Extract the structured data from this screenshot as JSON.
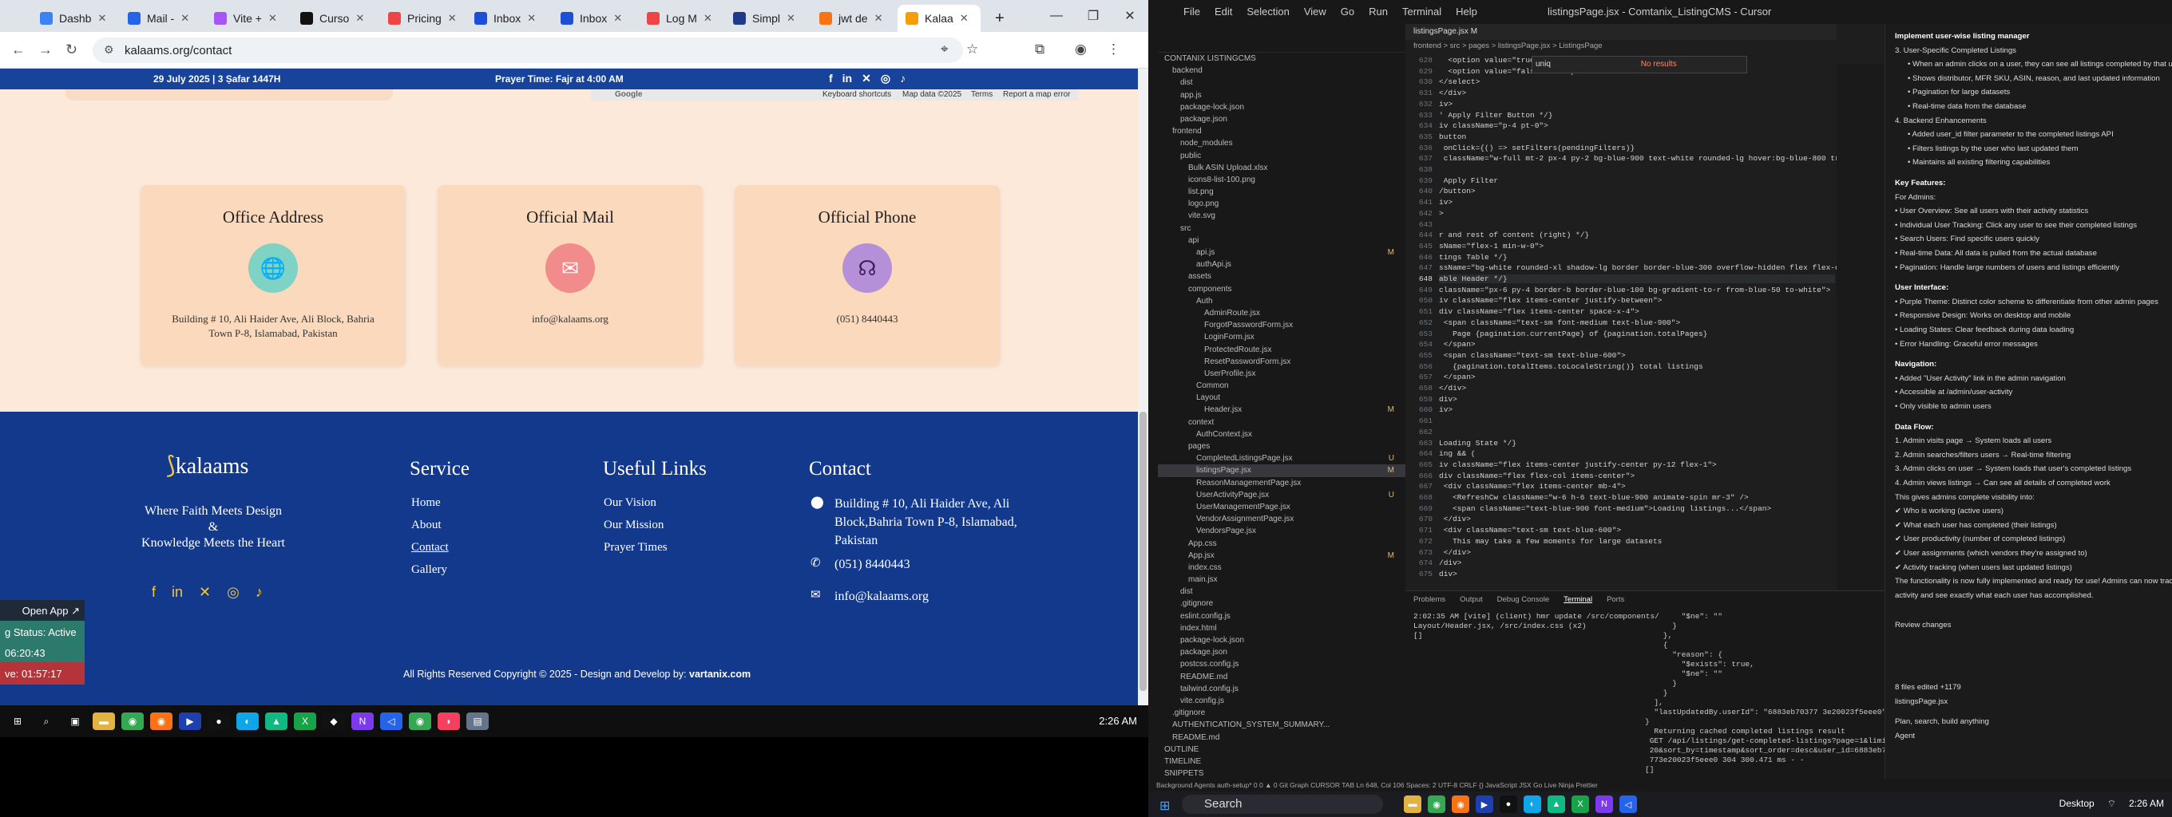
{
  "browser": {
    "tabs": [
      {
        "label": "Dashb",
        "color": "#3b82f6",
        "active": false
      },
      {
        "label": "Mail -",
        "color": "#2563eb",
        "active": false
      },
      {
        "label": "Vite +",
        "color": "#a855f7",
        "active": false
      },
      {
        "label": "Curso",
        "color": "#111111",
        "active": false
      },
      {
        "label": "Pricing",
        "color": "#ef4444",
        "active": false
      },
      {
        "label": "Inbox",
        "color": "#1d4ed8",
        "active": false
      },
      {
        "label": "Inbox",
        "color": "#1d4ed8",
        "active": false
      },
      {
        "label": "Log M",
        "color": "#ef4444",
        "active": false
      },
      {
        "label": "Simpl",
        "color": "#1e3a8a",
        "active": false
      },
      {
        "label": "jwt de",
        "color": "#f97316",
        "active": false
      },
      {
        "label": "Kalaa",
        "color": "#f59e0b",
        "active": true
      }
    ],
    "new_tab": "+",
    "url": "kalaams.org/contact",
    "window_controls": [
      "—",
      "❐",
      "✕"
    ]
  },
  "site": {
    "top_strip": {
      "date": "29 July 2025 | 3 Ṣafar 1447H",
      "prayer": "Prayer Time: Fajr at 4:00 AM"
    },
    "map": {
      "google": "Google",
      "shortcuts": "Keyboard shortcuts",
      "data": "Map data ©2025",
      "terms": "Terms",
      "report": "Report a map error"
    },
    "cards": [
      {
        "title": "Office Address",
        "icon": "globe-icon",
        "icon_color": "#7ed3c4",
        "text": "Building # 10, Ali Haider Ave, Ali Block, Bahria Town P-8, Islamabad, Pakistan"
      },
      {
        "title": "Official Mail",
        "icon": "mail-icon",
        "icon_color": "#f28b8b",
        "text": "info@kalaams.org"
      },
      {
        "title": "Official Phone",
        "icon": "headset-icon",
        "icon_color": "#b590d9",
        "text": "(051) 8440443"
      }
    ],
    "footer": {
      "logo": "kalaams",
      "tagline_1": "Where Faith Meets Design",
      "tagline_amp": "&",
      "tagline_2": "Knowledge Meets the Heart",
      "service_title": "Service",
      "service_links": [
        "Home",
        "About",
        "Contact",
        "Gallery"
      ],
      "useful_title": "Useful Links",
      "useful_links": [
        "Our Vision",
        "Our Mission",
        "Prayer Times"
      ],
      "contact_title": "Contact",
      "contact_address": "Building # 10, Ali Haider Ave, Ali Block,Bahria Town P-8, Islamabad, Pakistan",
      "contact_phone": "(051) 8440443",
      "contact_email": "info@kalaams.org",
      "copyright": "All Rights Reserved Copyright © 2025 - Design and Develop by:",
      "developer": "vartanix.com"
    },
    "debug": {
      "open_app": "Open App ↗",
      "status": "g Status: Active",
      "timer1": "06:20:43",
      "timer2": "ve: 01:57:17"
    }
  },
  "left_taskbar": {
    "time": "2:26 AM"
  },
  "code": {
    "menu": [
      "File",
      "Edit",
      "Selection",
      "View",
      "Go",
      "Run",
      "Terminal",
      "Help"
    ],
    "title": "listingsPage.jsx - Comtanix_ListingCMS - Cursor",
    "editor_tab": "listingsPage.jsx M",
    "breadcrumb": "frontend > src > pages > listingsPage.jsx > ListingsPage",
    "find_query": "uniq",
    "find_result": "No results",
    "explorer": [
      {
        "t": "CONTANIX LISTINGCMS",
        "d": 0
      },
      {
        "t": "backend",
        "d": 1
      },
      {
        "t": "dist",
        "d": 2
      },
      {
        "t": "app.js",
        "d": 2
      },
      {
        "t": "package-lock.json",
        "d": 2
      },
      {
        "t": "package.json",
        "d": 2
      },
      {
        "t": "frontend",
        "d": 1
      },
      {
        "t": "node_modules",
        "d": 2
      },
      {
        "t": "public",
        "d": 2
      },
      {
        "t": "Bulk ASIN Upload.xlsx",
        "d": 3
      },
      {
        "t": "icons8-list-100.png",
        "d": 3
      },
      {
        "t": "list.png",
        "d": 3
      },
      {
        "t": "logo.png",
        "d": 3
      },
      {
        "t": "vite.svg",
        "d": 3
      },
      {
        "t": "src",
        "d": 2
      },
      {
        "t": "api",
        "d": 3
      },
      {
        "t": "api.js",
        "d": 4,
        "m": "M"
      },
      {
        "t": "authApi.js",
        "d": 4
      },
      {
        "t": "assets",
        "d": 3
      },
      {
        "t": "components",
        "d": 3
      },
      {
        "t": "Auth",
        "d": 4
      },
      {
        "t": "AdminRoute.jsx",
        "d": 5
      },
      {
        "t": "ForgotPasswordForm.jsx",
        "d": 5
      },
      {
        "t": "LoginForm.jsx",
        "d": 5
      },
      {
        "t": "ProtectedRoute.jsx",
        "d": 5
      },
      {
        "t": "ResetPasswordForm.jsx",
        "d": 5
      },
      {
        "t": "UserProfile.jsx",
        "d": 5
      },
      {
        "t": "Common",
        "d": 4
      },
      {
        "t": "Layout",
        "d": 4
      },
      {
        "t": "Header.jsx",
        "d": 5,
        "m": "M"
      },
      {
        "t": "context",
        "d": 3
      },
      {
        "t": "AuthContext.jsx",
        "d": 4
      },
      {
        "t": "pages",
        "d": 3
      },
      {
        "t": "CompletedListingsPage.jsx",
        "d": 4,
        "m": "U"
      },
      {
        "t": "listingsPage.jsx",
        "d": 4,
        "m": "M"
      },
      {
        "t": "ReasonManagementPage.jsx",
        "d": 4
      },
      {
        "t": "UserActivityPage.jsx",
        "d": 4,
        "m": "U"
      },
      {
        "t": "UserManagementPage.jsx",
        "d": 4
      },
      {
        "t": "VendorAssignmentPage.jsx",
        "d": 4
      },
      {
        "t": "VendorsPage.jsx",
        "d": 4
      },
      {
        "t": "App.css",
        "d": 3
      },
      {
        "t": "App.jsx",
        "d": 3,
        "m": "M"
      },
      {
        "t": "index.css",
        "d": 3
      },
      {
        "t": "main.jsx",
        "d": 3
      },
      {
        "t": "dist",
        "d": 2
      },
      {
        "t": ".gitignore",
        "d": 2
      },
      {
        "t": "eslint.config.js",
        "d": 2
      },
      {
        "t": "index.html",
        "d": 2
      },
      {
        "t": "package-lock.json",
        "d": 2
      },
      {
        "t": "package.json",
        "d": 2
      },
      {
        "t": "postcss.config.js",
        "d": 2
      },
      {
        "t": "README.md",
        "d": 2
      },
      {
        "t": "tailwind.config.js",
        "d": 2
      },
      {
        "t": "vite.config.js",
        "d": 2
      },
      {
        "t": ".gitignore",
        "d": 1
      },
      {
        "t": "AUTHENTICATION_SYSTEM_SUMMARY...",
        "d": 1
      },
      {
        "t": "README.md",
        "d": 1
      },
      {
        "t": "OUTLINE",
        "d": 0
      },
      {
        "t": "TIMELINE",
        "d": 0
      },
      {
        "t": "SNIPPETS",
        "d": 0
      }
    ],
    "lines": [
      {
        "n": "628",
        "c": "  <option value=\"true\">Yes</option>"
      },
      {
        "n": "629",
        "c": "  <option value=\"false\">No</option>"
      },
      {
        "n": "630",
        "c": "</select>"
      },
      {
        "n": "631",
        "c": "</div>"
      },
      {
        "n": "632",
        "c": "iv>"
      },
      {
        "n": "633",
        "c": "' Apply Filter Button */}"
      },
      {
        "n": "634",
        "c": "iv className=\"p-4 pt-0\">"
      },
      {
        "n": "635",
        "c": "button"
      },
      {
        "n": "636",
        "c": " onClick={() => setFilters(pendingFilters)}"
      },
      {
        "n": "637",
        "c": " className=\"w-full mt-2 px-4 py-2 bg-blue-900 text-white rounded-lg hover:bg-blue-800 tr"
      },
      {
        "n": "638",
        "c": ""
      },
      {
        "n": "639",
        "c": " Apply Filter"
      },
      {
        "n": "640",
        "c": "/button>"
      },
      {
        "n": "641",
        "c": "iv>"
      },
      {
        "n": "642",
        "c": ">"
      },
      {
        "n": "643",
        "c": ""
      },
      {
        "n": "644",
        "c": "r and rest of content (right) */}"
      },
      {
        "n": "645",
        "c": "sName=\"flex-1 min-w-0\">"
      },
      {
        "n": "646",
        "c": "tings Table */}"
      },
      {
        "n": "647",
        "c": "ssName=\"bg-white rounded-xl shadow-lg border border-blue-300 overflow-hidden flex flex-co"
      },
      {
        "n": "648",
        "c": "able Header */}"
      },
      {
        "n": "649",
        "c": "className=\"px-6 py-4 border-b border-blue-100 bg-gradient-to-r from-blue-50 to-white\">"
      },
      {
        "n": "650",
        "c": "iv className=\"flex items-center justify-between\">"
      },
      {
        "n": "651",
        "c": "div className=\"flex items-center space-x-4\">"
      },
      {
        "n": "652",
        "c": " <span className=\"text-sm font-medium text-blue-900\">"
      },
      {
        "n": "653",
        "c": "   Page {pagination.currentPage} of {pagination.totalPages}"
      },
      {
        "n": "654",
        "c": " </span>"
      },
      {
        "n": "655",
        "c": " <span className=\"text-sm text-blue-600\">"
      },
      {
        "n": "656",
        "c": "   {pagination.totalItems.toLocaleString()} total listings"
      },
      {
        "n": "657",
        "c": " </span>"
      },
      {
        "n": "658",
        "c": "</div>"
      },
      {
        "n": "659",
        "c": "div>"
      },
      {
        "n": "660",
        "c": "iv>"
      },
      {
        "n": "661",
        "c": ""
      },
      {
        "n": "662",
        "c": ""
      },
      {
        "n": "663",
        "c": "Loading State */}"
      },
      {
        "n": "664",
        "c": "ing && ("
      },
      {
        "n": "665",
        "c": "iv className=\"flex items-center justify-center py-12 flex-1\">"
      },
      {
        "n": "666",
        "c": "div className=\"flex flex-col items-center\">"
      },
      {
        "n": "667",
        "c": " <div className=\"flex items-center mb-4\">"
      },
      {
        "n": "668",
        "c": "   <RefreshCw className=\"w-6 h-6 text-blue-900 animate-spin mr-3\" />"
      },
      {
        "n": "669",
        "c": "   <span className=\"text-blue-900 font-medium\">Loading listings...</span>"
      },
      {
        "n": "670",
        "c": " </div>"
      },
      {
        "n": "671",
        "c": " <div className=\"text-sm text-blue-600\">"
      },
      {
        "n": "672",
        "c": "   This may take a few moments for large datasets"
      },
      {
        "n": "673",
        "c": " </div>"
      },
      {
        "n": "674",
        "c": "/div>"
      },
      {
        "n": "675",
        "c": "div>"
      }
    ],
    "panel_tabs": [
      "Problems",
      "Output",
      "Debug Console",
      "Terminal",
      "Ports"
    ],
    "terminal_left": "2:02:35 AM [vite] (client) hmr update /src/components/\nLayout/Header.jsx, /src/index.css (x2)\n[]",
    "terminal_right": "        \"$ne\": \"\"\n      }\n    },\n    {\n      \"reason\": {\n        \"$exists\": true,\n        \"$ne\": \"\"\n      }\n    }\n  ],\n  \"lastUpdatedBy.userId\": \"6883eb70377 3e20023f5eee0\"\n}\n  Returning cached completed listings result\n GET /api/listings/get-completed-listings?page=1&limit=\n 20&sort_by=timestamp&sort_order=desc&user_id=6883eb703\n 773e20023f5eee0 304 300.471 ms - -\n[]",
    "chat": [
      {
        "t": "Implement user-wise listing manager",
        "k": "b"
      },
      {
        "t": "3. User-Specific Completed Listings",
        "k": "n"
      },
      {
        "t": "• When an admin clicks on a user, they can see all listings completed by that user",
        "k": "s"
      },
      {
        "t": "• Shows distributor, MFR SKU, ASIN, reason, and last updated information",
        "k": "s"
      },
      {
        "t": "• Pagination for large datasets",
        "k": "s"
      },
      {
        "t": "• Real-time data from the database",
        "k": "s"
      },
      {
        "t": "4. Backend Enhancements",
        "k": "n"
      },
      {
        "t": "• Added user_id filter parameter to the completed listings API",
        "k": "s"
      },
      {
        "t": "• Filters listings by the user who last updated them",
        "k": "s"
      },
      {
        "t": "• Maintains all existing filtering capabilities",
        "k": "s"
      },
      {
        "t": "Key Features:",
        "k": "b"
      },
      {
        "t": "For Admins:",
        "k": "n"
      },
      {
        "t": "• User Overview: See all users with their activity statistics",
        "k": "n"
      },
      {
        "t": "• Individual User Tracking: Click any user to see their completed listings",
        "k": "n"
      },
      {
        "t": "• Search Users: Find specific users quickly",
        "k": "n"
      },
      {
        "t": "• Real-time Data: All data is pulled from the actual database",
        "k": "n"
      },
      {
        "t": "• Pagination: Handle large numbers of users and listings efficiently",
        "k": "n"
      },
      {
        "t": "User Interface:",
        "k": "b"
      },
      {
        "t": "• Purple Theme: Distinct color scheme to differentiate from other admin pages",
        "k": "n"
      },
      {
        "t": "• Responsive Design: Works on desktop and mobile",
        "k": "n"
      },
      {
        "t": "• Loading States: Clear feedback during data loading",
        "k": "n"
      },
      {
        "t": "• Error Handling: Graceful error messages",
        "k": "n"
      },
      {
        "t": "Navigation:",
        "k": "b"
      },
      {
        "t": "• Added \"User Activity\" link in the admin navigation",
        "k": "n"
      },
      {
        "t": "• Accessible at /admin/user-activity",
        "k": "n"
      },
      {
        "t": "• Only visible to admin users",
        "k": "n"
      },
      {
        "t": "Data Flow:",
        "k": "b"
      },
      {
        "t": "1. Admin visits page → System loads all users",
        "k": "n"
      },
      {
        "t": "2. Admin searches/filters users → Real-time filtering",
        "k": "n"
      },
      {
        "t": "3. Admin clicks on user → System loads that user's completed listings",
        "k": "n"
      },
      {
        "t": "4. Admin views listings → Can see all details of completed work",
        "k": "n"
      },
      {
        "t": "This gives admins complete visibility into:",
        "k": "n"
      },
      {
        "t": "✔ Who is working (active users)",
        "k": "n"
      },
      {
        "t": "✔ What each user has completed (their listings)",
        "k": "n"
      },
      {
        "t": "✔ User productivity (number of completed listings)",
        "k": "n"
      },
      {
        "t": "✔ User assignments (which vendors they're assigned to)",
        "k": "n"
      },
      {
        "t": "✔ Activity tracking (when users last updated listings)",
        "k": "n"
      },
      {
        "t": "The functionality is now fully implemented and ready for use! Admins can now track user",
        "k": "n"
      },
      {
        "t": "activity and see exactly what each user has accomplished.",
        "k": "n"
      },
      {
        "t": "Review changes",
        "k": "n"
      },
      {
        "t": "8 files edited +1179",
        "k": "n"
      },
      {
        "t": "listingsPage.jsx",
        "k": "n"
      },
      {
        "t": "Plan, search, build anything",
        "k": "n"
      },
      {
        "t": "Agent",
        "k": "n"
      }
    ],
    "status_bar": "Background Agents   auth-setup*   0   0 ▲ 0   Git Graph   CURSOR TAB   Ln 648, Col 106   Spaces: 2   UTF-8   CRLF   {} JavaScript JSX   Go Live   Ninja   Prettier"
  },
  "right_taskbar": {
    "search": "Search",
    "desktop": "Desktop",
    "time": "2:26 AM"
  }
}
